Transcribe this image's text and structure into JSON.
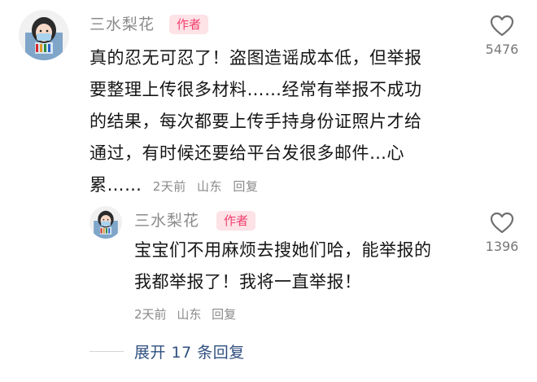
{
  "comment": {
    "username": "三水梨花",
    "badge": "作者",
    "lines": [
      "真的忍无可忍了！盗图造谣成本低，但举报",
      "要整理上传很多材料……经常有举报不成功",
      "的结果，每次都要上传手持身份证照片才给",
      "通过，有时候还要给平台发很多邮件…心"
    ],
    "last_line": "累……",
    "time": "2天前",
    "location": "山东",
    "reply_label": "回复",
    "like_count": "5476"
  },
  "reply": {
    "username": "三水梨花",
    "badge": "作者",
    "lines": [
      "宝宝们不用麻烦去搜她们哈，能举报的",
      "我都举报了！我将一直举报！"
    ],
    "time": "2天前",
    "location": "山东",
    "reply_label": "回复",
    "like_count": "1396"
  },
  "expand_label": "展开 17 条回复",
  "colors": {
    "badge_bg": "#fde2e6",
    "badge_text": "#f2406e",
    "link": "#2f4f7f",
    "meta": "#8a8a8a"
  },
  "icons": [
    "avatar",
    "heart-outline-icon"
  ]
}
